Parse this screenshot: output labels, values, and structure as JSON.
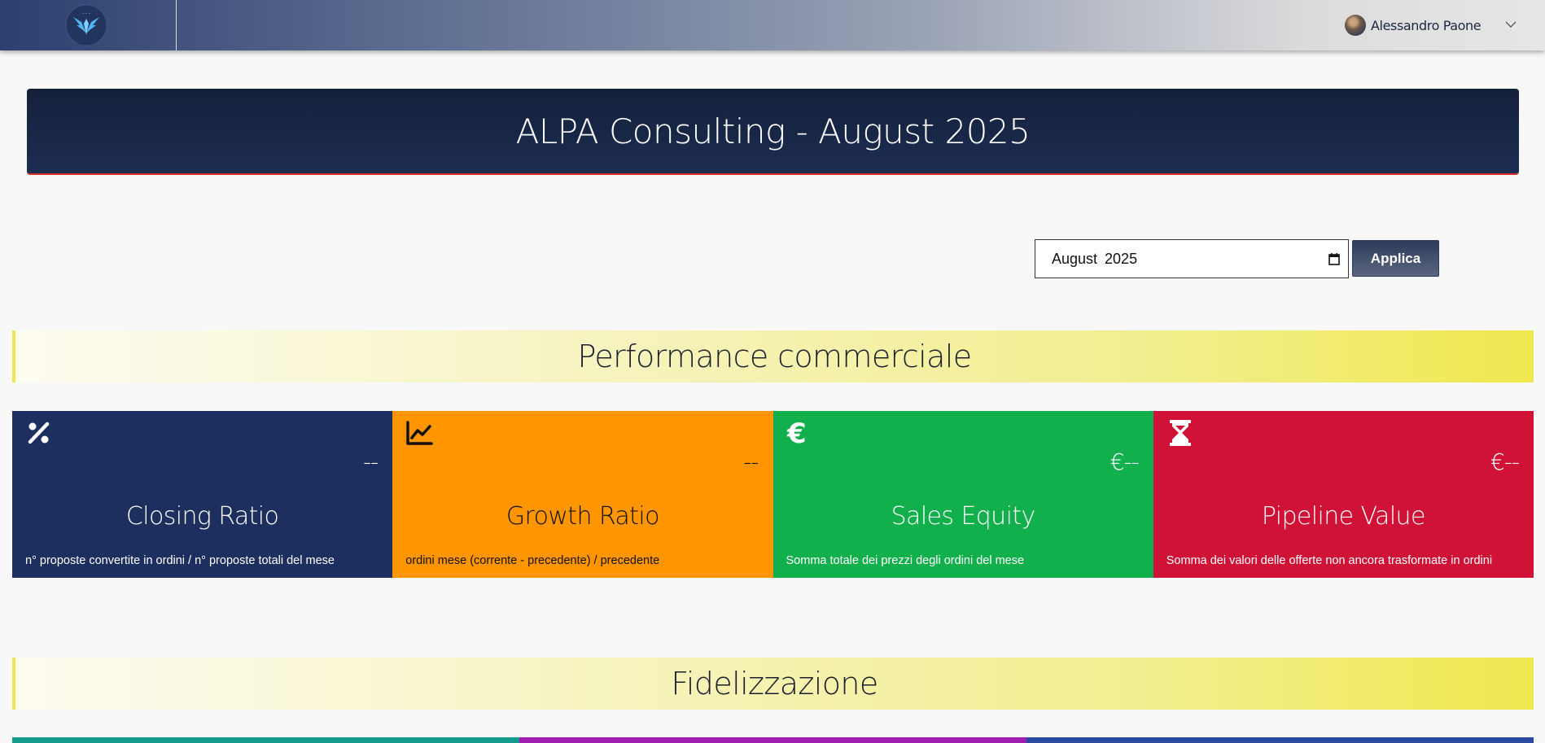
{
  "header": {
    "logo": "app-logo",
    "user_name": "Alessandro Paone"
  },
  "banner": {
    "title": "ALPA Consulting - August 2025"
  },
  "filter": {
    "month_value": "August 2025",
    "apply_label": "Applica"
  },
  "sections": [
    {
      "title": "Performance commerciale"
    },
    {
      "title": "Fidelizzazione"
    }
  ],
  "kpis": [
    {
      "icon": "percent-icon",
      "value": "--",
      "title": "Closing Ratio",
      "desc": "n° proposte convertite in ordini / n° proposte totali del mese",
      "color": "#1c2f5e",
      "text_color": "#ffffff"
    },
    {
      "icon": "line-chart-icon",
      "value": "--",
      "title": "Growth Ratio",
      "desc": "ordini mese (corrente - precedente) / precedente",
      "color": "#ff9500",
      "text_color": "#111111"
    },
    {
      "icon": "euro-icon",
      "value": "€--",
      "title": "Sales Equity",
      "desc": "Somma totale dei prezzi degli ordini del mese",
      "color": "#12b04c",
      "text_color": "#ffffff"
    },
    {
      "icon": "hourglass-icon",
      "value": "€--",
      "title": "Pipeline Value",
      "desc": "Somma dei valori delle offerte non ancora trasformate in ordini",
      "color": "#d01236",
      "text_color": "#ffffff"
    }
  ],
  "bottom_strip_colors": [
    "#139c8c",
    "#a21caf",
    "#2a4aa0"
  ]
}
